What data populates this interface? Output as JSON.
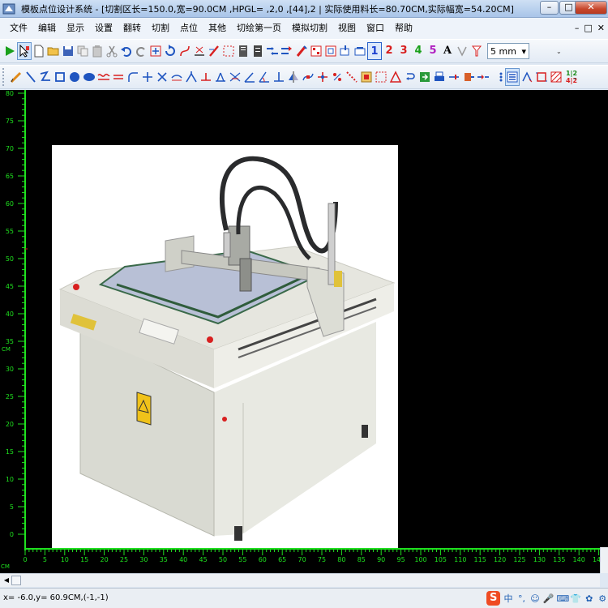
{
  "window": {
    "title": "模板点位设计系统 - [切割区长=150.0,宽=90.0CM ,HPGL= ,2,0 ,[44],2 | 实际使用料长=80.70CM,实际幅宽=54.20CM]",
    "minimize": "–",
    "maximize": "□",
    "close": "✕"
  },
  "menu": {
    "items": [
      "文件",
      "编辑",
      "显示",
      "设置",
      "翻转",
      "切割",
      "点位",
      "其他",
      "切绘第一页",
      "模拟切割",
      "视图",
      "窗口",
      "帮助"
    ],
    "mdi_controls": [
      "–",
      "□",
      "✕"
    ]
  },
  "toolbar1": {
    "layers": [
      "1",
      "2",
      "3",
      "4",
      "5"
    ],
    "layer_colors": [
      "#1a3fcf",
      "#d81e1e",
      "#d81e1e",
      "#1aa01a",
      "#b01fc0"
    ],
    "text_tool": "A",
    "size_value": "5 mm"
  },
  "toolbar2": {
    "grid_label_top": "1|2",
    "grid_label_bottom": "4|2"
  },
  "canvas": {
    "vruler_unit": "CM",
    "hruler_unit": "CM",
    "vruler_ticks": [
      "80",
      "75",
      "70",
      "65",
      "60",
      "55",
      "50",
      "45",
      "40",
      "35",
      "30",
      "25",
      "20",
      "15",
      "10",
      "5",
      "0"
    ],
    "hruler_ticks": [
      "0",
      "5",
      "10",
      "15",
      "20",
      "25",
      "30",
      "35",
      "40",
      "45",
      "50",
      "55",
      "60",
      "65",
      "70",
      "75",
      "80",
      "85",
      "90",
      "95",
      "100",
      "105",
      "110",
      "115",
      "120",
      "125",
      "130",
      "135",
      "140",
      "145"
    ]
  },
  "status": {
    "coords": "x= -6.0,y= 60.9CM,(-1,-1)",
    "ime_logo": "S",
    "ime_items": [
      "中",
      "°,",
      "☺",
      "🎤",
      "⌨",
      "👕",
      "✿",
      "⚙"
    ]
  },
  "colors": {
    "ruler": "#1fe01f",
    "canvas_bg": "#000000",
    "cursor_marker": "#e02020"
  }
}
